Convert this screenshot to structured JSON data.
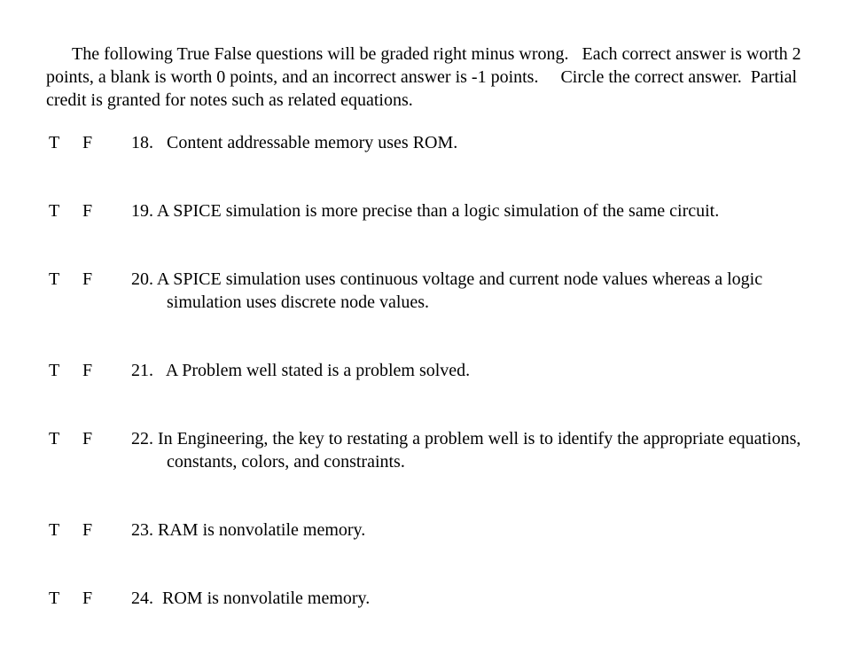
{
  "document": {
    "background_color": "#ffffff",
    "text_color": "#000000",
    "intro": "   The following True False questions will be graded right minus wrong.   Each correct answer is worth 2 points, a blank is worth 0 points, and an incorrect answer is -1 points.     Circle the correct answer.  Partial credit is granted for notes such as related equations.",
    "answer_options": {
      "true_label": "T",
      "false_label": "F"
    },
    "questions": [
      {
        "number": "18.",
        "text": "18.   Content addressable memory uses ROM.",
        "wrapped": false
      },
      {
        "number": "19.",
        "text": "19. A SPICE simulation is more precise than a logic simulation of the same circuit.",
        "wrapped": false
      },
      {
        "number": "20.",
        "text": "20. A SPICE simulation uses continuous voltage and current node values whereas a logic simulation uses discrete node values.",
        "wrapped": true
      },
      {
        "number": "21.",
        "text": "21.   A Problem well stated is a problem solved.",
        "wrapped": false
      },
      {
        "number": "22.",
        "text": "22. In Engineering, the key to restating a problem well is to identify the appropriate equations, constants, colors, and constraints.",
        "wrapped": true
      },
      {
        "number": "23.",
        "text": "23. RAM is nonvolatile memory.",
        "wrapped": false
      },
      {
        "number": "24.",
        "text": "24.  ROM is nonvolatile memory.",
        "wrapped": false
      }
    ]
  }
}
